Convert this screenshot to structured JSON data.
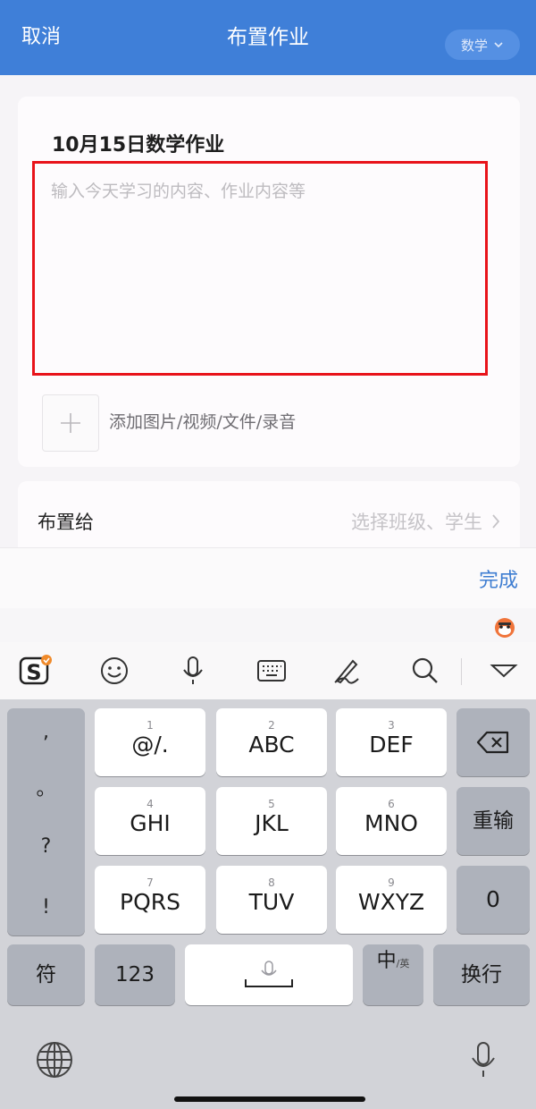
{
  "header": {
    "cancel_label": "取消",
    "title": "布置作业",
    "subject_label": "数学"
  },
  "homework": {
    "title": "10月15日数学作业",
    "content_value": "",
    "content_placeholder": "输入今天学习的内容、作业内容等",
    "attachment_label": "添加图片/视频/文件/录音"
  },
  "assign": {
    "label": "布置给",
    "value": "选择班级、学生"
  },
  "accessory": {
    "done_label": "完成"
  },
  "keyboard": {
    "punctuation": [
      ",",
      "。",
      "?",
      "!"
    ],
    "keys": [
      {
        "num": "1",
        "label": "@/."
      },
      {
        "num": "2",
        "label": "ABC"
      },
      {
        "num": "3",
        "label": "DEF"
      },
      {
        "num": "4",
        "label": "GHI"
      },
      {
        "num": "5",
        "label": "JKL"
      },
      {
        "num": "6",
        "label": "MNO"
      },
      {
        "num": "7",
        "label": "PQRS"
      },
      {
        "num": "8",
        "label": "TUV"
      },
      {
        "num": "9",
        "label": "WXYZ"
      }
    ],
    "reenter_label": "重输",
    "zero_label": "0",
    "symbols_label": "符",
    "numbers_label": "123",
    "lang_main": "中",
    "lang_sub": "/英",
    "return_label": "换行"
  },
  "colors": {
    "header_bg": "#3f7fd8",
    "accent": "#3e7dd1",
    "highlight_border": "#e8131a"
  }
}
